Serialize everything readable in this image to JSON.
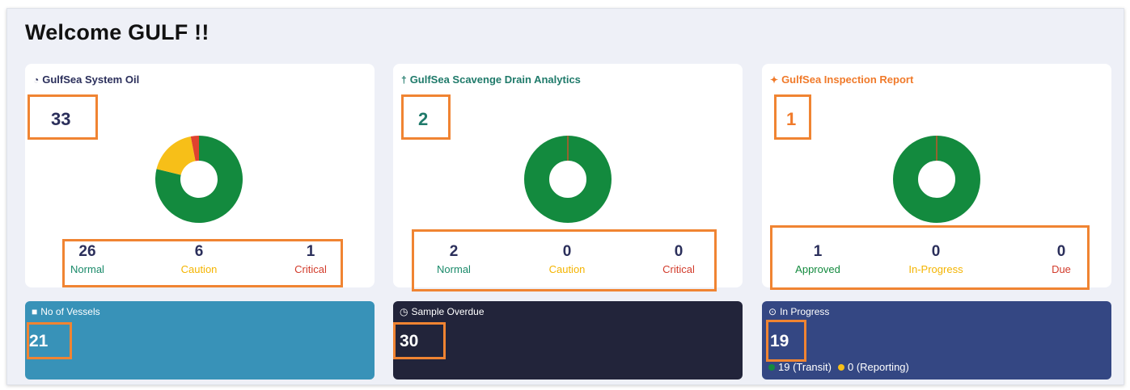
{
  "page": {
    "title": "Welcome GULF !!"
  },
  "cards": [
    {
      "title": "GulfSea System Oil",
      "icon": "oil-drop-icon",
      "total": "33",
      "color": "#2b2f5b",
      "stats": [
        {
          "value": "26",
          "label": "Normal",
          "color": "#1a8a6a"
        },
        {
          "value": "6",
          "label": "Caution",
          "color": "#f4b400"
        },
        {
          "value": "1",
          "label": "Critical",
          "color": "#d23b2b"
        }
      ],
      "chart_data": {
        "type": "pie",
        "categories": [
          "Normal",
          "Caution",
          "Critical"
        ],
        "values": [
          26,
          6,
          1
        ],
        "colors": [
          "#138a3e",
          "#f7bf18",
          "#e0432f"
        ]
      }
    },
    {
      "title": "GulfSea Scavenge Drain Analytics",
      "icon": "drain-icon",
      "total": "2",
      "color": "#1f7a6a",
      "stats": [
        {
          "value": "2",
          "label": "Normal",
          "color": "#1a8a6a"
        },
        {
          "value": "0",
          "label": "Caution",
          "color": "#f4b400"
        },
        {
          "value": "0",
          "label": "Critical",
          "color": "#d23b2b"
        }
      ],
      "chart_data": {
        "type": "pie",
        "categories": [
          "Normal",
          "Caution",
          "Critical"
        ],
        "values": [
          2,
          0,
          0
        ],
        "colors": [
          "#138a3e",
          "#f7bf18",
          "#e0432f"
        ]
      }
    },
    {
      "title": "GulfSea Inspection Report",
      "icon": "inspection-icon",
      "total": "1",
      "color": "#f07a2a",
      "stats": [
        {
          "value": "1",
          "label": "Approved",
          "color": "#138a3e"
        },
        {
          "value": "0",
          "label": "In-Progress",
          "color": "#f4b400"
        },
        {
          "value": "0",
          "label": "Due",
          "color": "#d23b2b"
        }
      ],
      "chart_data": {
        "type": "pie",
        "categories": [
          "Approved",
          "In-Progress",
          "Due"
        ],
        "values": [
          1,
          0,
          0
        ],
        "colors": [
          "#138a3e",
          "#f7bf18",
          "#e0432f"
        ]
      }
    }
  ],
  "tiles": [
    {
      "label": "No of Vessels",
      "icon": "ship-icon",
      "value": "21",
      "bg": "#3892b8"
    },
    {
      "label": "Sample Overdue",
      "icon": "clock-icon",
      "value": "30",
      "bg": "#22243a"
    },
    {
      "label": "In Progress",
      "icon": "progress-icon",
      "value": "19",
      "bg": "#344783",
      "foot": {
        "transit": "19 (Transit)",
        "reporting": "0 (Reporting)",
        "transit_color": "#138a3e",
        "reporting_color": "#f7bf18"
      }
    }
  ]
}
